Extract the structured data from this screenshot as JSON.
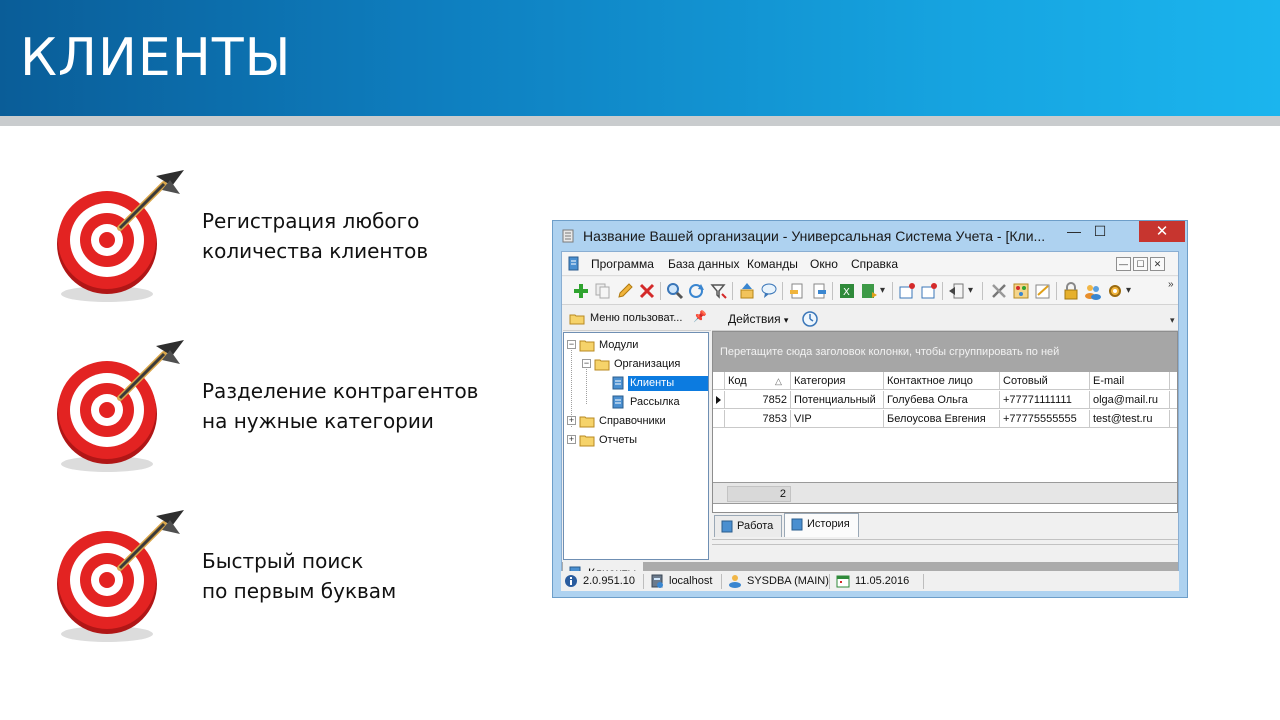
{
  "slide": {
    "title": "КЛИЕНТЫ",
    "features": [
      {
        "line1": "Регистрация любого",
        "line2": "количества клиентов"
      },
      {
        "line1": "Разделение контрагентов",
        "line2": "на нужные категории"
      },
      {
        "line1": "Быстрый поиск",
        "line2": "по первым буквам"
      }
    ]
  },
  "window": {
    "title": "Название Вашей организации - Универсальная Система Учета - [Кли...",
    "controls": {
      "minimize": "—",
      "maximize": "☐",
      "close": "✕"
    }
  },
  "menu": {
    "items": [
      "Программа",
      "База данных",
      "Команды",
      "Окно",
      "Справка"
    ]
  },
  "toolbar": {
    "icons": [
      "add-icon",
      "copy-icon",
      "edit-icon",
      "delete-icon",
      "search-icon",
      "refresh-icon",
      "filter-icon",
      "up-icon",
      "comment-icon",
      "import-icon",
      "export-icon",
      "excel-icon",
      "excel-export-icon",
      "new-window-icon",
      "new-window2-icon",
      "exit-icon",
      "tools-icon",
      "palette-icon",
      "notes-icon",
      "lock-icon",
      "users-icon",
      "settings-icon"
    ]
  },
  "left_panel": {
    "header": "Меню пользоват...",
    "tree": [
      {
        "label": "Модули",
        "expander": "−",
        "level": 0,
        "type": "folder"
      },
      {
        "label": "Организация",
        "expander": "−",
        "level": 1,
        "type": "folder"
      },
      {
        "label": "Клиенты",
        "expander": "",
        "level": 2,
        "type": "doc",
        "selected": true
      },
      {
        "label": "Рассылка",
        "expander": "",
        "level": 2,
        "type": "doc"
      },
      {
        "label": "Справочники",
        "expander": "+",
        "level": 0,
        "type": "folder"
      },
      {
        "label": "Отчеты",
        "expander": "+",
        "level": 0,
        "type": "folder"
      }
    ]
  },
  "actions": {
    "label": "Действия",
    "arrow": "▾",
    "more": "▾"
  },
  "grid": {
    "group_hint": "Перетащите сюда заголовок колонки, чтобы сгруппировать по ней",
    "columns": [
      "Код",
      "Категория",
      "Контактное лицо",
      "Сотовый",
      "E-mail"
    ],
    "sort_glyph": "△",
    "rows": [
      {
        "code": "7852",
        "category": "Потенциальный",
        "contact": "Голубева Ольга",
        "mobile": "+77771111111",
        "email": "olga@mail.ru"
      },
      {
        "code": "7853",
        "category": "VIP",
        "contact": "Белоусова Евгения",
        "mobile": "+77775555555",
        "email": "test@test.ru"
      }
    ],
    "footer_count": "2"
  },
  "sub_tabs": [
    "Работа",
    "История"
  ],
  "mdi_tab": "Клиенты",
  "status": {
    "version": "2.0.951.10",
    "server": "localhost",
    "user": "SYSDBA (MAIN)",
    "date": "11.05.2016"
  },
  "colors": {
    "banner_start": "#0a5d98",
    "banner_end": "#1bb5ee",
    "target_red": "#e32322",
    "selection_blue": "#0c7be0"
  }
}
